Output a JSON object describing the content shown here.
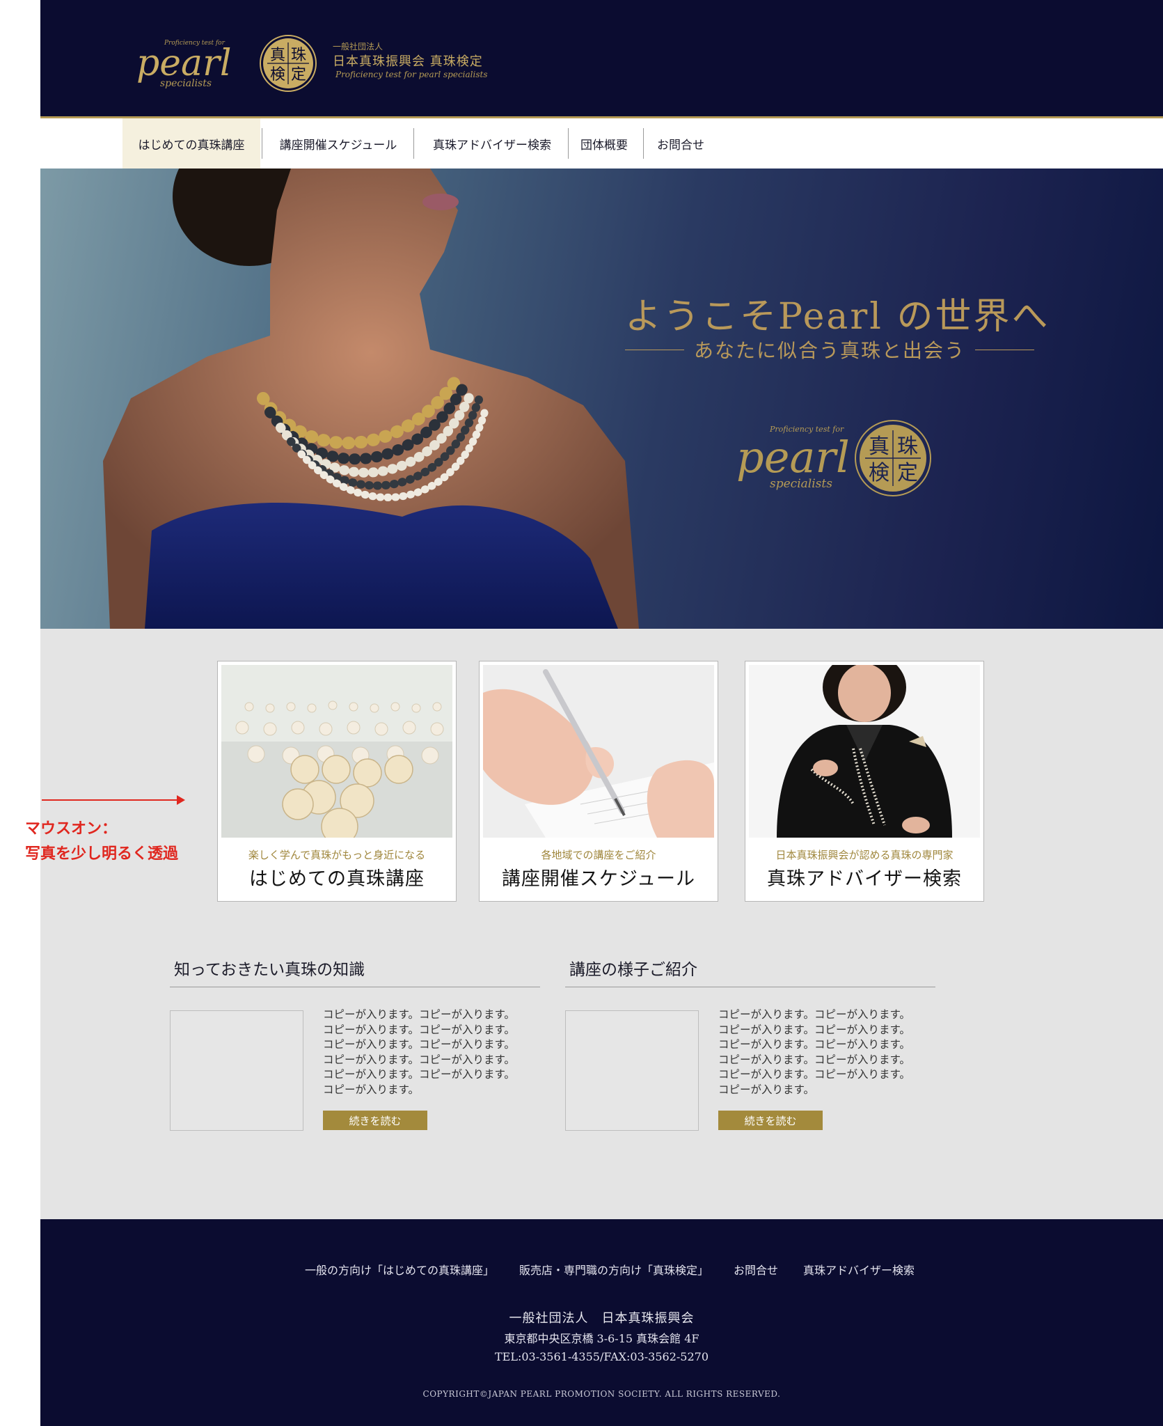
{
  "header": {
    "logo": {
      "script_word": "pearl",
      "script_sub": "specialists",
      "tagline": "Proficiency test for",
      "seal_chars": [
        "真",
        "珠",
        "検",
        "定"
      ]
    },
    "org_type": "一般社団法人",
    "org_title": "日本真珠振興会 真珠検定",
    "org_subtitle": "Proficiency test for pearl specialists"
  },
  "nav": {
    "items": [
      {
        "label": "はじめての真珠講座",
        "active": true
      },
      {
        "label": "講座開催スケジュール",
        "active": false
      },
      {
        "label": "真珠アドバイザー検索",
        "active": false
      },
      {
        "label": "団体概要",
        "active": false
      },
      {
        "label": "お問合せ",
        "active": false
      }
    ]
  },
  "hero": {
    "title": "ようこそPearl の世界へ",
    "subtitle": "あなたに似合う真珠と出会う",
    "logo": {
      "script_word": "pearl",
      "script_sub": "specialists",
      "tagline": "Proficiency test for",
      "seal_chars": [
        "真",
        "珠",
        "検",
        "定"
      ]
    }
  },
  "annotation": {
    "line1": "マウスオン：",
    "line2": "写真を少し明るく透過"
  },
  "cards": [
    {
      "caption": "楽しく学んで真珠がもっと身近になる",
      "title": "はじめての真珠講座",
      "photo": "pearls-photo"
    },
    {
      "caption": "各地域での講座をご紹介",
      "title": "講座開催スケジュール",
      "photo": "writing-photo"
    },
    {
      "caption": "日本真珠振興会が認める真珠の専門家",
      "title": "真珠アドバイザー検索",
      "photo": "advisor-photo"
    }
  ],
  "news": [
    {
      "heading": "知っておきたい真珠の知識",
      "body_lines": [
        "コピーが入ります。コピーが入ります。",
        "コピーが入ります。コピーが入ります。",
        "コピーが入ります。コピーが入ります。",
        "コピーが入ります。コピーが入ります。",
        "コピーが入ります。コピーが入ります。",
        "コピーが入ります。"
      ],
      "button": "続きを読む"
    },
    {
      "heading": "講座の様子ご紹介",
      "body_lines": [
        "コピーが入ります。コピーが入ります。",
        "コピーが入ります。コピーが入ります。",
        "コピーが入ります。コピーが入ります。",
        "コピーが入ります。コピーが入ります。",
        "コピーが入ります。コピーが入ります。",
        "コピーが入ります。"
      ],
      "button": "続きを読む"
    }
  ],
  "footer": {
    "links": [
      "一般の方向け「はじめての真珠講座」",
      "販売店・専門職の方向け「真珠検定」",
      "お問合せ",
      "真珠アドバイザー検索"
    ],
    "org": "一般社団法人　日本真珠振興会",
    "address": "東京都中央区京橋 3-6-15 真珠会館 4F",
    "tel": "TEL:03-3561-4355/FAX:03-3562-5270",
    "copyright": "COPYRIGHT©JAPAN PEARL PROMOTION SOCIETY. ALL RIGHTS RESERVED."
  },
  "colors": {
    "navy": "#0b0c30",
    "gold": "#b59b55",
    "nav_active_bg": "#f5f0de",
    "section_gray": "#e4e4e4",
    "button_gold": "#a38a3c",
    "annotation_red": "#e0271f"
  }
}
